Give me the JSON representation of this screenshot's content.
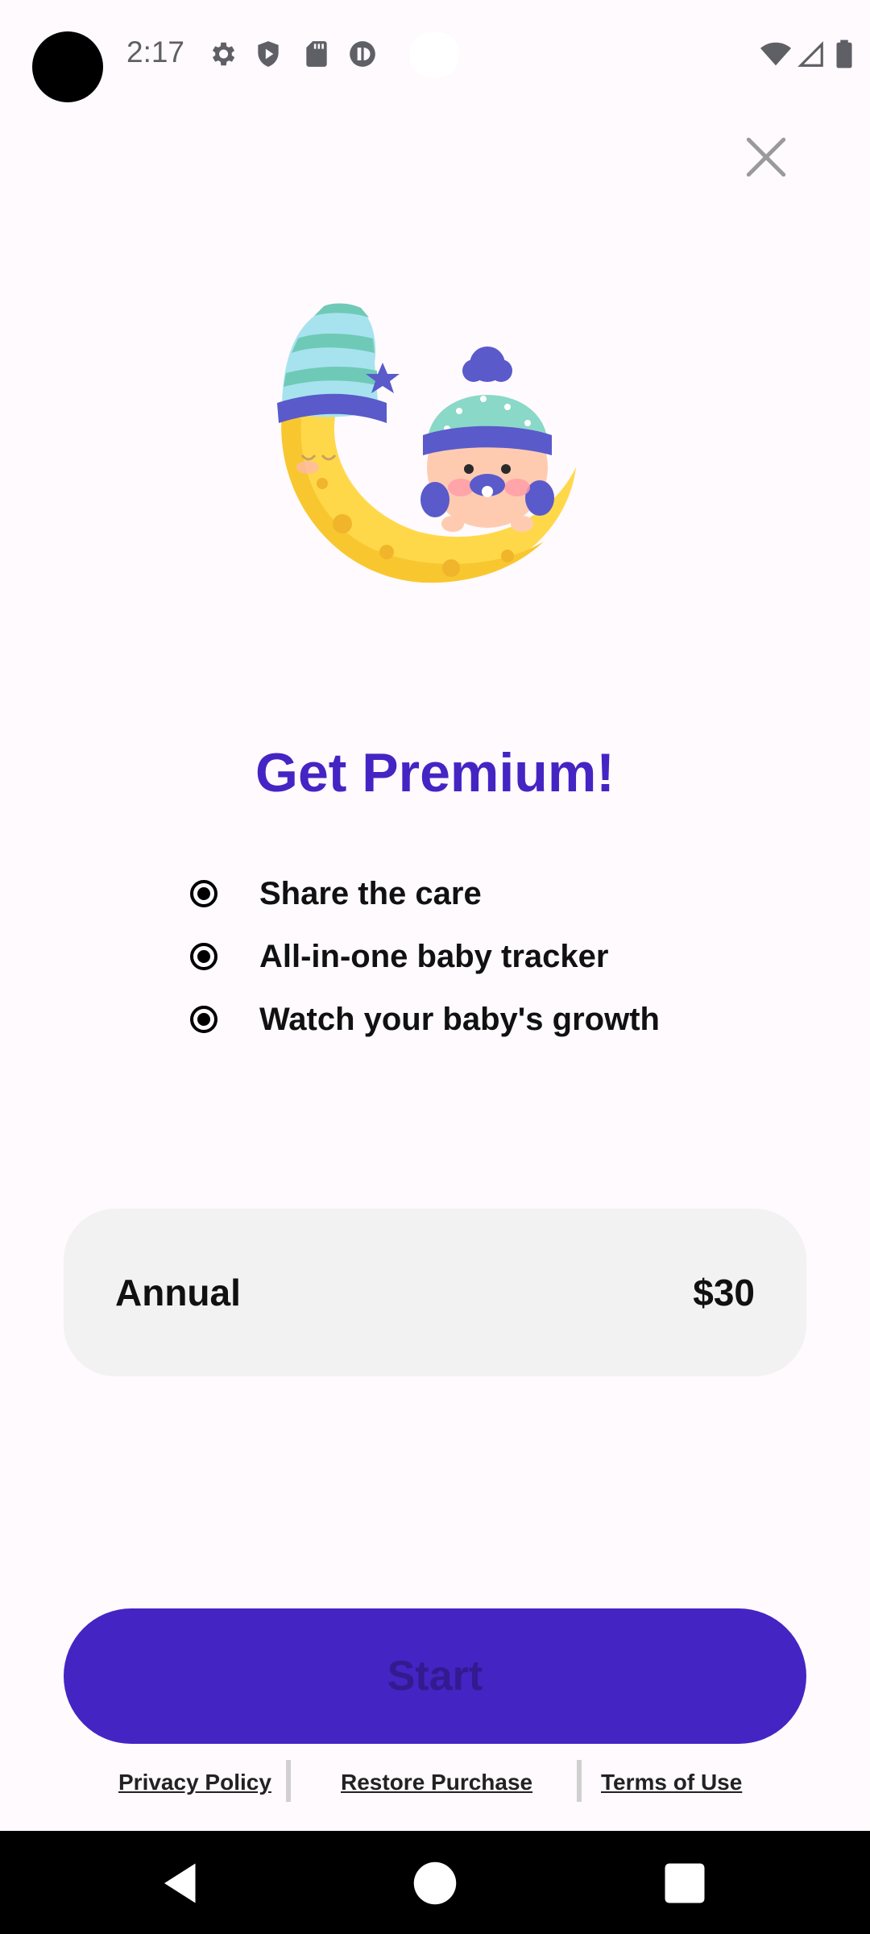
{
  "status_bar": {
    "time": "2:17",
    "icons": [
      "settings-icon",
      "shield-icon",
      "sd-card-icon",
      "app-notification-icon",
      "wifi-icon",
      "signal-icon",
      "battery-icon"
    ]
  },
  "close": {
    "icon": "close-icon"
  },
  "illustration": {
    "subject": "baby-on-moon-illustration"
  },
  "title": "Get Premium!",
  "features": [
    "Share the care",
    "All-in-one baby tracker",
    "Watch your baby's growth"
  ],
  "plan": {
    "name": "Annual",
    "price": "$30"
  },
  "cta": {
    "label": "Start"
  },
  "footer": {
    "privacy": "Privacy Policy",
    "restore": "Restore Purchase",
    "terms": "Terms of Use"
  },
  "nav": {
    "icons": [
      "back-icon",
      "home-icon",
      "recents-icon"
    ]
  },
  "colors": {
    "accent": "#4524c4",
    "background": "#fefafd",
    "card": "#f2f2f2"
  }
}
